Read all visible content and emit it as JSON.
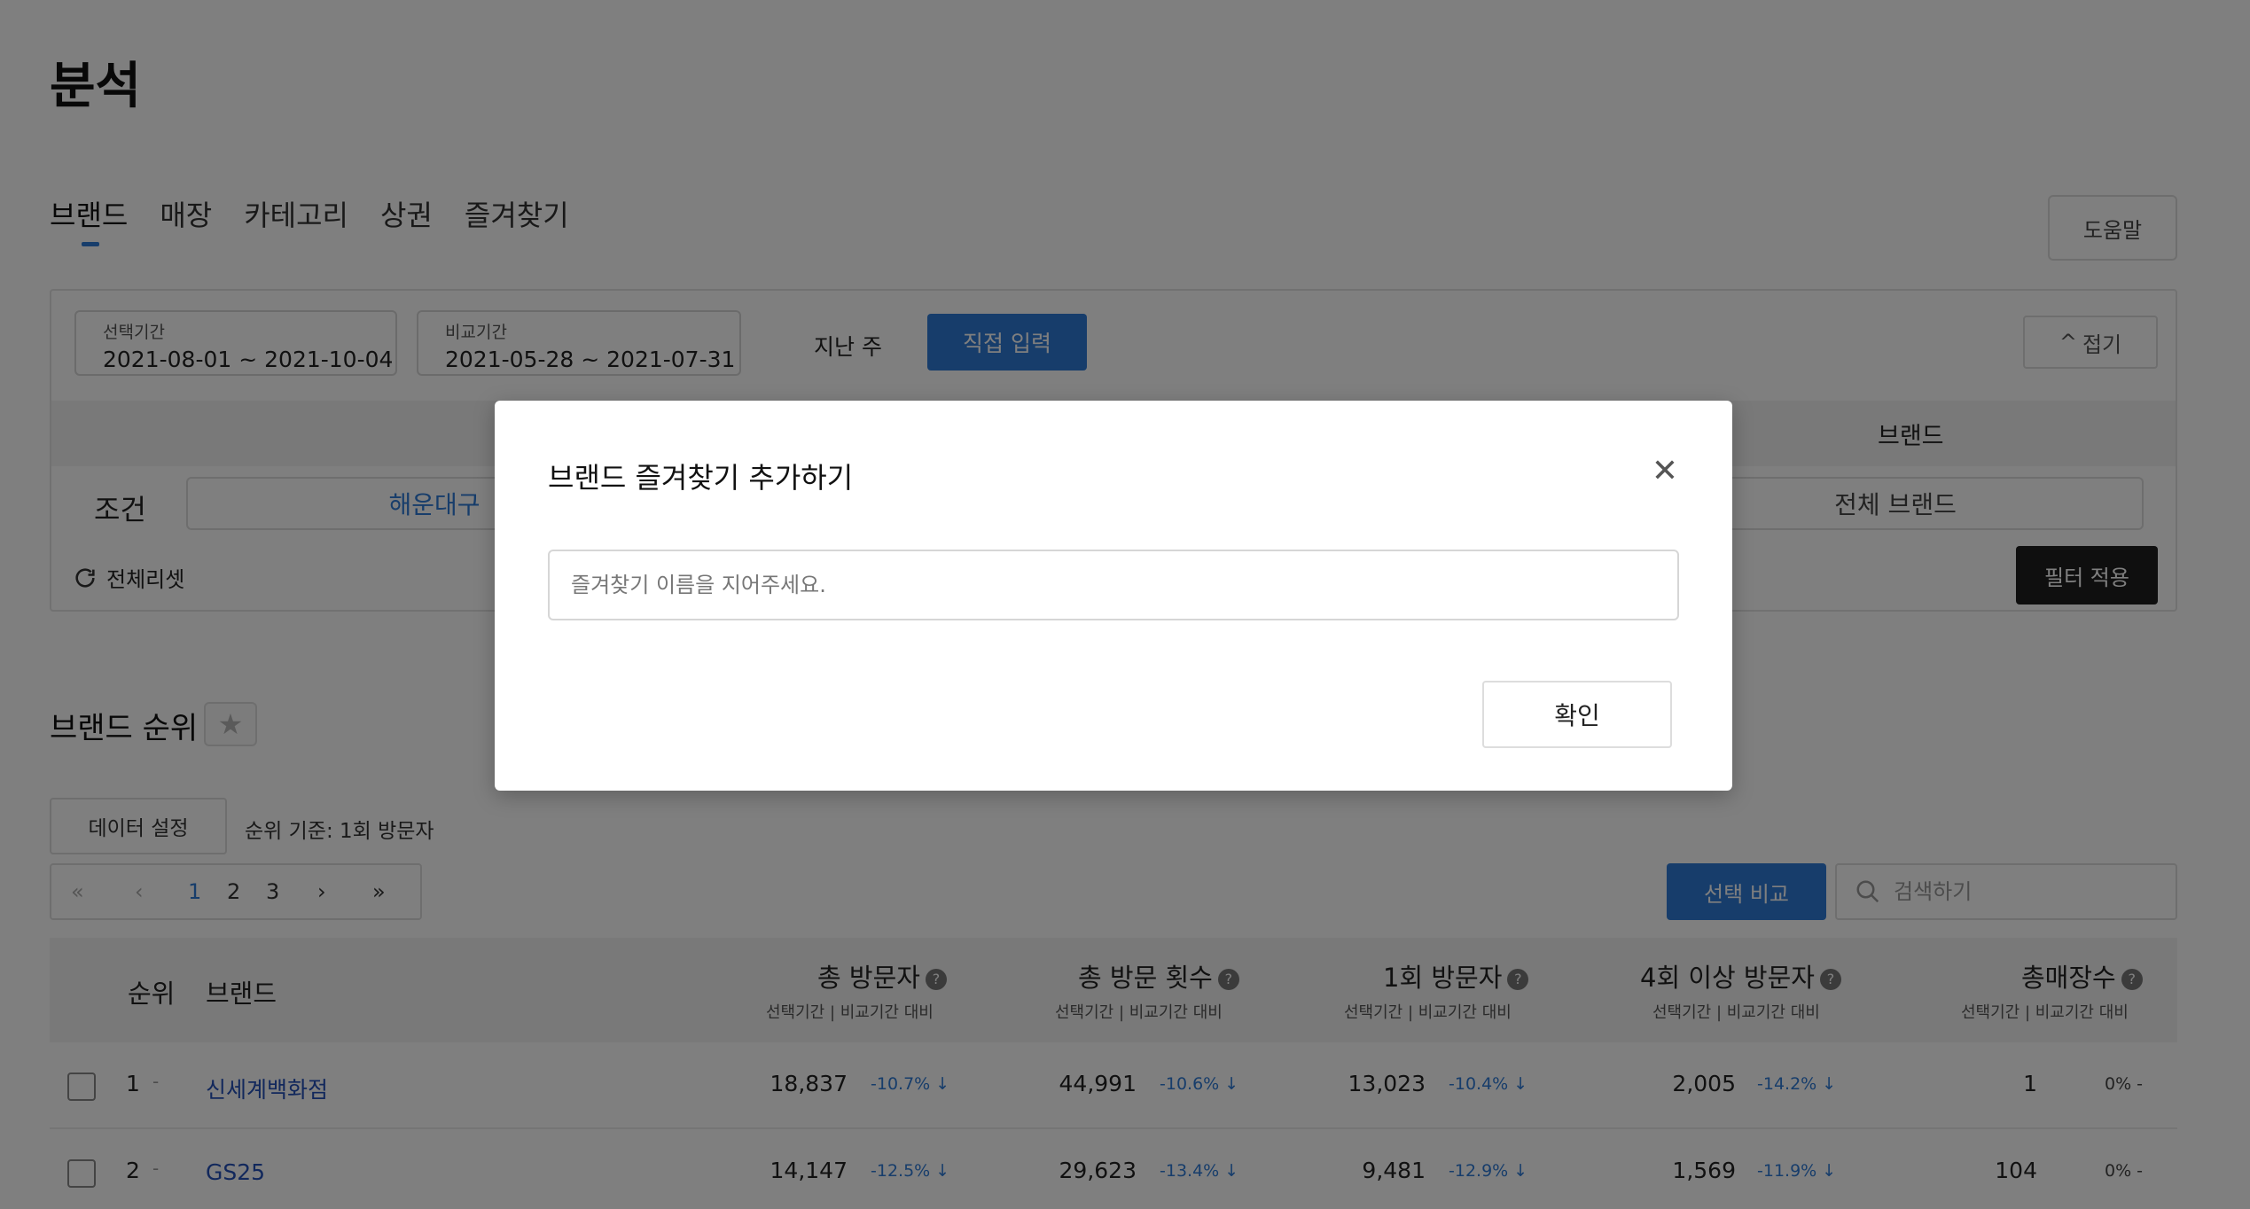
{
  "page": {
    "title": "분석"
  },
  "tabs": [
    {
      "label": "브랜드"
    },
    {
      "label": "매장"
    },
    {
      "label": "카테고리"
    },
    {
      "label": "상권"
    },
    {
      "label": "즐겨찾기"
    }
  ],
  "help_label": "도움말",
  "filter": {
    "selected_period": {
      "label": "선택기간",
      "value": "2021-08-01 ~ 2021-10-04"
    },
    "compare_period": {
      "label": "비교기간",
      "value": "2021-05-28 ~ 2021-07-31"
    },
    "last_week_label": "지난 주",
    "direct_input_label": "직접 입력",
    "collapse_label": "접기",
    "brand_col_header": "브랜드",
    "condition_label": "조건",
    "condition_left_value": "해운대구",
    "condition_right_value": "전체 브랜드",
    "reset_label": "전체리셋",
    "apply_label": "필터 적용"
  },
  "ranking": {
    "title": "브랜드 순위",
    "data_setting_label": "데이터 설정",
    "rank_basis": "순위 기준: 1회 방문자",
    "pager": {
      "pages": [
        "1",
        "2",
        "3"
      ],
      "current": "1"
    },
    "compare_label": "선택 비교",
    "search_placeholder": "검색하기",
    "columns": {
      "rank": "순위",
      "brand": "브랜드",
      "total_visitors": "총 방문자",
      "total_visits": "총 방문 횟수",
      "one_time_visitors": "1회 방문자",
      "four_plus_visitors": "4회 이상 방문자",
      "total_stores": "총매장수",
      "sub": "선택기간 | 비교기간 대비"
    },
    "rows": [
      {
        "rank": "1",
        "rank_delta": "-",
        "brand": "신세계백화점",
        "total_visitors": "18,837",
        "total_visitors_pct": "-10.7% ↓",
        "total_visits": "44,991",
        "total_visits_pct": "-10.6% ↓",
        "one_time": "13,023",
        "one_time_pct": "-10.4% ↓",
        "four_plus": "2,005",
        "four_plus_pct": "-14.2% ↓",
        "stores": "1",
        "stores_pct": "0% -"
      },
      {
        "rank": "2",
        "rank_delta": "-",
        "brand": "GS25",
        "total_visitors": "14,147",
        "total_visitors_pct": "-12.5% ↓",
        "total_visits": "29,623",
        "total_visits_pct": "-13.4% ↓",
        "one_time": "9,481",
        "one_time_pct": "-12.9% ↓",
        "four_plus": "1,569",
        "four_plus_pct": "-11.9% ↓",
        "stores": "104",
        "stores_pct": "0% -"
      }
    ]
  },
  "modal": {
    "title": "브랜드 즐겨찾기 추가하기",
    "input_placeholder": "즐겨찾기 이름을 지어주세요.",
    "input_value": "",
    "confirm_label": "확인"
  },
  "colors": {
    "accent": "#2f7bd6",
    "dark_button": "#1f1f1f",
    "link": "#2450b8"
  }
}
